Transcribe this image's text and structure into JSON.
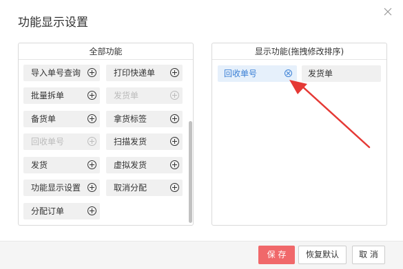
{
  "dialog": {
    "title": "功能显示设置"
  },
  "left_panel": {
    "header": "全部功能",
    "items": [
      {
        "label": "导入单号查询",
        "enabled": true
      },
      {
        "label": "打印快递单",
        "enabled": true
      },
      {
        "label": "批量拆单",
        "enabled": true
      },
      {
        "label": "发货单",
        "enabled": false
      },
      {
        "label": "备货单",
        "enabled": true
      },
      {
        "label": "拿货标签",
        "enabled": true
      },
      {
        "label": "回收单号",
        "enabled": false
      },
      {
        "label": "扫描发货",
        "enabled": true
      },
      {
        "label": "发货",
        "enabled": true
      },
      {
        "label": "虚拟发货",
        "enabled": true
      },
      {
        "label": "功能显示设置",
        "enabled": true
      },
      {
        "label": "取消分配",
        "enabled": true
      },
      {
        "label": "分配订单",
        "enabled": true
      }
    ]
  },
  "right_panel": {
    "header": "显示功能(拖拽修改排序)",
    "items": [
      {
        "label": "回收单号",
        "active": true
      },
      {
        "label": "发货单",
        "active": false
      }
    ]
  },
  "buttons": {
    "save": "保 存",
    "restore_default": "恢复默认",
    "cancel": "取 消"
  },
  "colors": {
    "primary_button": "#f0686a",
    "active_item_bg": "#e6f0fb",
    "active_item_text": "#3a7fd5",
    "annotation_arrow": "#e53935"
  }
}
